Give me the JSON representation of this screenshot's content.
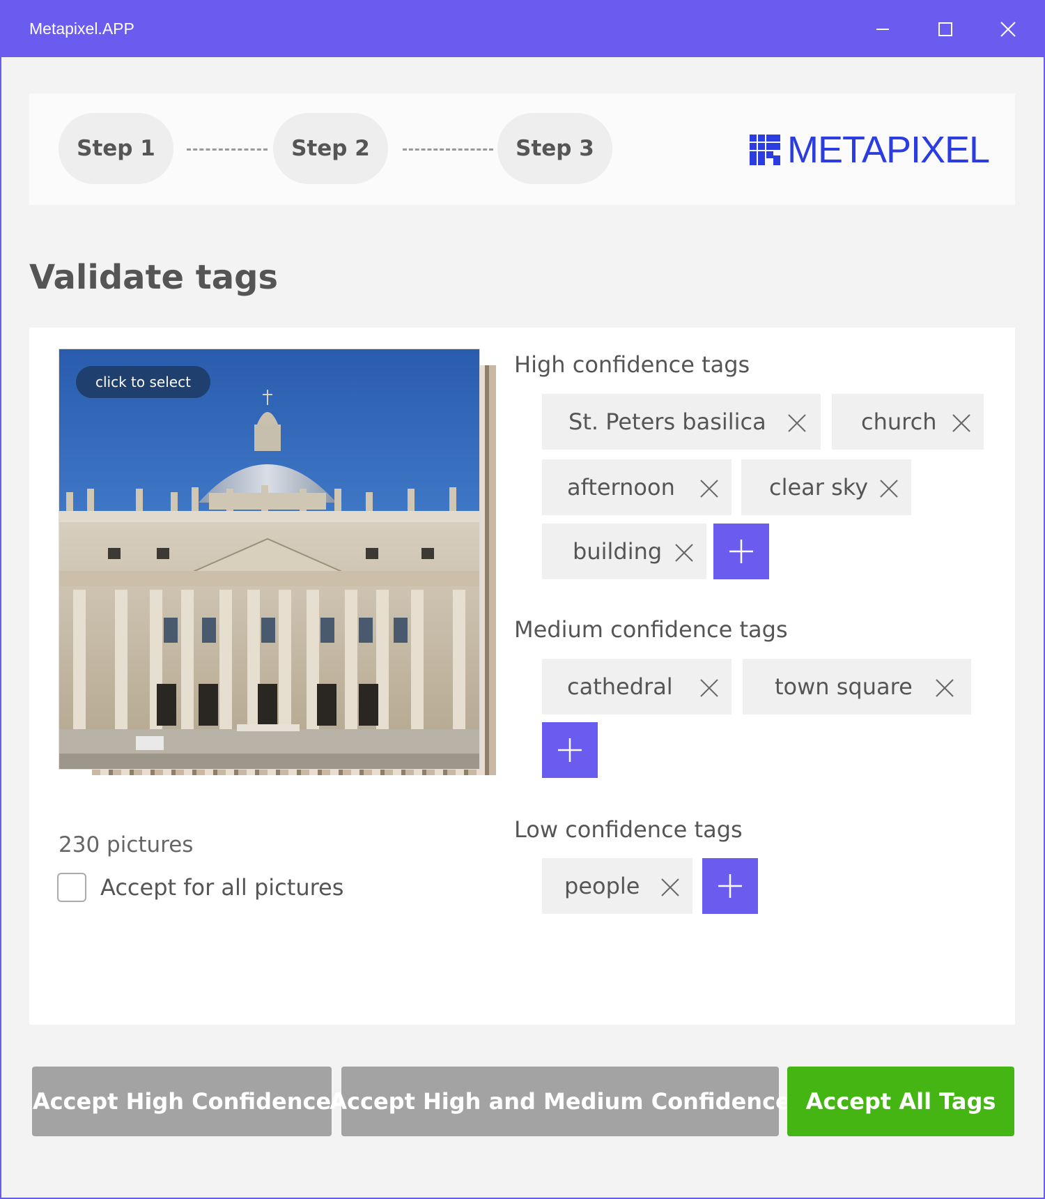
{
  "window": {
    "title": "Metapixel.APP",
    "accent_color": "#6b5cf0"
  },
  "stepper": {
    "steps": [
      "Step 1",
      "Step 2",
      "Step 3"
    ],
    "logo_text": "METAPIXEL",
    "logo_color": "#2b3de0"
  },
  "page": {
    "title": "Validate tags"
  },
  "image_panel": {
    "badge": "click to select",
    "picture_count": "230 pictures",
    "accept_all_label": "Accept for all pictures",
    "accept_all_checked": false
  },
  "tags": {
    "high": {
      "title": "High confidence tags",
      "items": [
        "St. Peters basilica",
        "church",
        "afternoon",
        "clear sky",
        "building"
      ]
    },
    "medium": {
      "title": "Medium confidence tags",
      "items": [
        "cathedral",
        "town square"
      ]
    },
    "low": {
      "title": "Low confidence tags",
      "items": [
        "people"
      ]
    }
  },
  "actions": {
    "accept_high": "Accept High Confidence",
    "accept_high_medium": "Accept High and Medium Confidence",
    "accept_all": "Accept All Tags",
    "accept_all_color": "#44b513",
    "secondary_color": "#a3a3a3"
  },
  "icons": {
    "minimize": "minimize-icon",
    "maximize": "maximize-icon",
    "close": "close-icon",
    "tag_remove": "x-icon",
    "add": "plus-icon"
  }
}
